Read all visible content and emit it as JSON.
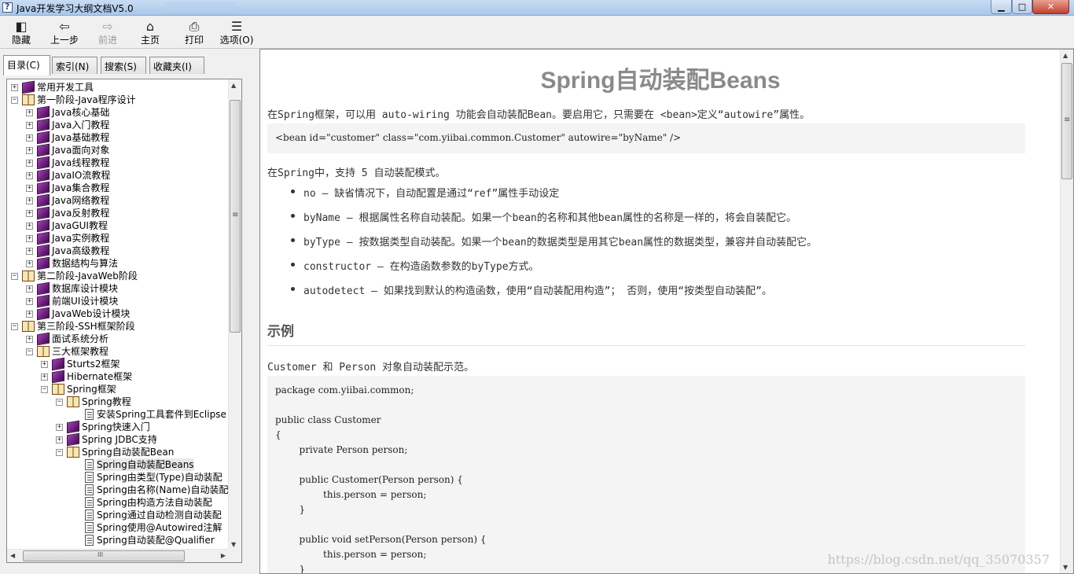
{
  "window": {
    "title": "Java开发学习大纲文档V5.0",
    "controls": {
      "minimize": "▁",
      "maximize": "□",
      "close": "✕"
    }
  },
  "toolbar": {
    "hide": {
      "label": "隐藏",
      "icon": "hide-icon",
      "glyph": "◧"
    },
    "back": {
      "label": "上一步",
      "icon": "back-arrow-icon",
      "glyph": "⇦"
    },
    "forward": {
      "label": "前进",
      "icon": "forward-arrow-icon",
      "glyph": "⇨"
    },
    "home": {
      "label": "主页",
      "icon": "home-icon",
      "glyph": "⌂"
    },
    "print": {
      "label": "打印",
      "icon": "printer-icon",
      "glyph": "⎙"
    },
    "options": {
      "label": "选项(O)",
      "icon": "options-icon",
      "glyph": "☰"
    }
  },
  "nav_tabs": [
    "目录(C)",
    "索引(N)",
    "搜索(S)",
    "收藏夹(I)"
  ],
  "tree": {
    "expand_glyph": "+",
    "collapse_glyph": "−",
    "nodes": [
      {
        "label": "常用开发工具",
        "level": 0,
        "state": "closed"
      },
      {
        "label": "第一阶段-Java程序设计",
        "level": 0,
        "state": "open"
      },
      {
        "label": "Java核心基础",
        "level": 1,
        "state": "closed"
      },
      {
        "label": "Java入门教程",
        "level": 1,
        "state": "closed"
      },
      {
        "label": "Java基础教程",
        "level": 1,
        "state": "closed"
      },
      {
        "label": "Java面向对象",
        "level": 1,
        "state": "closed"
      },
      {
        "label": "Java线程教程",
        "level": 1,
        "state": "closed"
      },
      {
        "label": "JavaIO流教程",
        "level": 1,
        "state": "closed"
      },
      {
        "label": "Java集合教程",
        "level": 1,
        "state": "closed"
      },
      {
        "label": "Java网络教程",
        "level": 1,
        "state": "closed"
      },
      {
        "label": "Java反射教程",
        "level": 1,
        "state": "closed"
      },
      {
        "label": "JavaGUI教程",
        "level": 1,
        "state": "closed"
      },
      {
        "label": "Java实例教程",
        "level": 1,
        "state": "closed"
      },
      {
        "label": "Java高级教程",
        "level": 1,
        "state": "closed"
      },
      {
        "label": "数据结构与算法",
        "level": 1,
        "state": "closed"
      },
      {
        "label": "第二阶段-JavaWeb阶段",
        "level": 0,
        "state": "open"
      },
      {
        "label": "数据库设计模块",
        "level": 1,
        "state": "closed"
      },
      {
        "label": "前端UI设计模块",
        "level": 1,
        "state": "closed"
      },
      {
        "label": "JavaWeb设计模块",
        "level": 1,
        "state": "closed"
      },
      {
        "label": "第三阶段-SSH框架阶段",
        "level": 0,
        "state": "open"
      },
      {
        "label": "面试系统分析",
        "level": 1,
        "state": "closed"
      },
      {
        "label": "三大框架教程",
        "level": 1,
        "state": "open"
      },
      {
        "label": "Sturts2框架",
        "level": 2,
        "state": "closed"
      },
      {
        "label": "Hibernate框架",
        "level": 2,
        "state": "closed"
      },
      {
        "label": "Spring框架",
        "level": 2,
        "state": "open"
      },
      {
        "label": "Spring教程",
        "level": 3,
        "state": "open"
      },
      {
        "label": "安装Spring工具套件到Eclipse",
        "level": 4,
        "state": "page"
      },
      {
        "label": "Spring快速入门",
        "level": 3,
        "state": "closed"
      },
      {
        "label": "Spring JDBC支持",
        "level": 3,
        "state": "closed"
      },
      {
        "label": "Spring自动装配Bean",
        "level": 3,
        "state": "open"
      },
      {
        "label": "Spring自动装配Beans",
        "level": 4,
        "state": "page",
        "selected": true
      },
      {
        "label": "Spring由类型(Type)自动装配",
        "level": 4,
        "state": "page"
      },
      {
        "label": "Spring由名称(Name)自动装配",
        "level": 4,
        "state": "page"
      },
      {
        "label": "Spring由构造方法自动装配",
        "level": 4,
        "state": "page"
      },
      {
        "label": "Spring通过自动检测自动装配",
        "level": 4,
        "state": "page"
      },
      {
        "label": "Spring使用@Autowired注解",
        "level": 4,
        "state": "page"
      },
      {
        "label": "Spring自动装配@Qualifier",
        "level": 4,
        "state": "page"
      }
    ]
  },
  "article": {
    "title": "Spring自动装配Beans",
    "intro": "在Spring框架，可以用 auto-wiring 功能会自动装配Bean。要启用它，只需要在 <bean>定义“autowire”属性。",
    "code1": "<bean id=\"customer\" class=\"com.yiibai.common.Customer\" autowire=\"byName\" />",
    "modes_intro": "在Spring中，支持 5 自动装配模式。",
    "modes": [
      "no – 缺省情况下，自动配置是通过“ref”属性手动设定",
      "byName – 根据属性名称自动装配。如果一个bean的名称和其他bean属性的名称是一样的，将会自装配它。",
      "byType – 按数据类型自动装配。如果一个bean的数据类型是用其它bean属性的数据类型，兼容并自动装配它。",
      "constructor – 在构造函数参数的byType方式。",
      "autodetect – 如果找到默认的构造函数，使用“自动装配用构造”； 否则，使用“按类型自动装配”。"
    ],
    "example_heading": "示例",
    "example_intro": "Customer 和 Person 对象自动装配示范。",
    "code2": [
      "package com.yiibai.common;",
      "",
      "public class Customer",
      "{",
      "        private Person person;",
      "",
      "        public Customer(Person person) {",
      "                this.person = person;",
      "        }",
      "",
      "        public void setPerson(Person person) {",
      "                this.person = person;",
      "        }"
    ]
  },
  "watermark": "https://blog.csdn.net/qq_35070357",
  "scroll_glyphs": {
    "up": "▲",
    "down": "▼",
    "left": "◀",
    "right": "▶",
    "grip": "≡",
    "hgrip": "III"
  }
}
